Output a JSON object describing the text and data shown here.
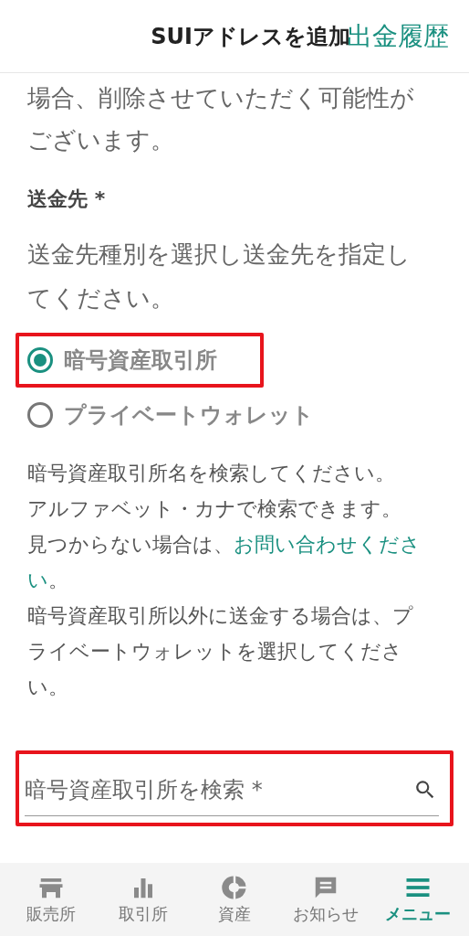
{
  "header": {
    "title": "SUIアドレスを追加",
    "link": "出金履歴"
  },
  "notice": "場合、削除させていただく可能性がございます。",
  "destination": {
    "label": "送金先 *",
    "instruction": "送金先種別を選択し送金先を指定してください。",
    "options": [
      {
        "label": "暗号資産取引所",
        "selected": true,
        "highlighted": true
      },
      {
        "label": "プライベートウォレット",
        "selected": false,
        "highlighted": false
      }
    ],
    "help": [
      {
        "text": "暗号資産取引所名を検索してください。"
      },
      {
        "text": "アルファベット・カナで検索できます。"
      },
      {
        "text": "見つからない場合は、",
        "link": [
          "お問い合わせくださ",
          "い"
        ],
        "after": "。"
      },
      {
        "text": "暗号資産取引所以外に送金する場合は、プライベートウォレットを選択してください。"
      }
    ],
    "search": {
      "placeholder": "暗号資産取引所を検索 *",
      "highlighted": true
    }
  },
  "nav": [
    {
      "kind": "store",
      "label": "販売所",
      "selected": false
    },
    {
      "kind": "chart",
      "label": "取引所",
      "selected": false
    },
    {
      "kind": "pie",
      "label": "資産",
      "selected": false
    },
    {
      "kind": "message",
      "label": "お知らせ",
      "selected": false
    },
    {
      "kind": "menu",
      "label": "メニュー",
      "selected": true
    }
  ]
}
